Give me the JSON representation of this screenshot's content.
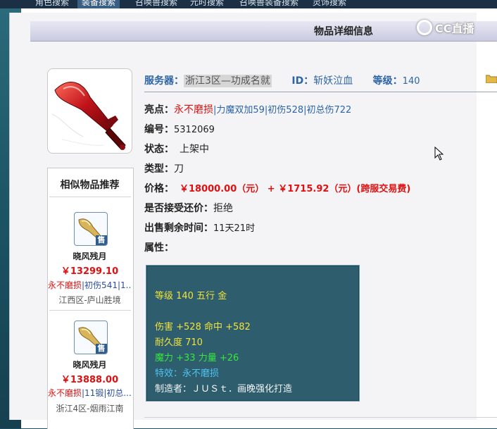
{
  "top_nav": {
    "tabs": [
      {
        "label": "角色搜索"
      },
      {
        "label": "装备搜索",
        "active": true
      },
      {
        "label": "召唤兽搜索"
      },
      {
        "label": "元时搜索"
      },
      {
        "label": "召唤兽装备搜索"
      },
      {
        "label": "灵饰搜索"
      }
    ]
  },
  "header": {
    "title": "物品详细信息"
  },
  "watermark": {
    "text": "CC直播"
  },
  "item": {
    "icon": "red-broadsword-icon",
    "server_label": "服务器：",
    "server_value": "浙江3区—功成名就",
    "id_label": "ID：",
    "id_value": "斩妖泣血",
    "level_label": "等级：",
    "level_value": "140",
    "highlights_label": "亮点：",
    "highlight_red": "永不磨损",
    "highlight_rest": "|力魔双加59|初伤528|初总伤722",
    "number_label": "编号：",
    "number_value": "5312069",
    "status_label": "状态：",
    "status_value": "上架中",
    "type_label": "类型：",
    "type_value": "刀",
    "price_label": "价格：",
    "price_value": "￥18000.00（元） + ￥1715.92（元）(跨服交易费)",
    "bargain_label": "是否接受还价：",
    "bargain_value": "拒绝",
    "remaining_label": "出售剩余时间：",
    "remaining_value": "11天21时",
    "attributes_label": "属性："
  },
  "attributes": {
    "line1": "等级 140  五行 金",
    "line2": "伤害 +528 命中 +582",
    "line3": "耐久度 710",
    "line4": "魔力 +33 力量 +26",
    "line5": "特效：永不磨损",
    "line6": "制造者：ＪＵＳｔ．画晚强化打造"
  },
  "similar": {
    "title": "相似物品推荐",
    "items": [
      {
        "name": "晓风残月",
        "price": "￥13299.10",
        "tag_red": "永不磨损",
        "tag_rest": "|初伤541|1...",
        "server": "江西区-庐山胜境",
        "badge": "售"
      },
      {
        "name": "晓风残月",
        "price": "￥13888.00",
        "tag_red": "永不磨损",
        "tag_rest": "|11锻|初总...",
        "server": "浙江4区-烟雨江南",
        "badge": "售"
      }
    ]
  },
  "colors": {
    "accent_blue": "#2c64a6",
    "price_red": "#e01010",
    "attr_bg": "#2e5e6e",
    "attr_yellow": "#f2e23a",
    "attr_green": "#35e83a",
    "attr_cyan": "#4fc3f0"
  }
}
